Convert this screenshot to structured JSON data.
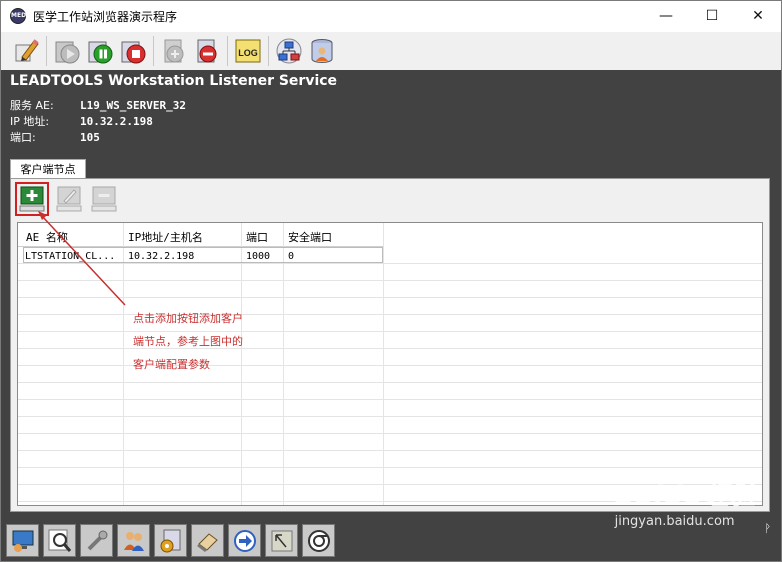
{
  "window": {
    "title": "医学工作站浏览器演示程序",
    "app_icon_text": "MED",
    "controls": {
      "minimize": "—",
      "maximize": "☐",
      "close": "✕"
    }
  },
  "toolbar": {
    "items": [
      {
        "name": "edit-pencil-icon"
      },
      {
        "name": "start-service-icon"
      },
      {
        "name": "pause-service-icon"
      },
      {
        "name": "stop-service-icon"
      },
      {
        "name": "add-server-icon"
      },
      {
        "name": "remove-server-icon"
      },
      {
        "name": "log-icon",
        "text": "LOG"
      },
      {
        "name": "network-icon"
      },
      {
        "name": "database-user-icon"
      }
    ]
  },
  "service": {
    "title": "LEADTOOLS Workstation Listener Service",
    "ae_label": "服务 AE:",
    "ae_value": "L19_WS_SERVER_32",
    "ip_label": "IP 地址:",
    "ip_value": "10.32.2.198",
    "port_label": "端口:",
    "port_value": "105"
  },
  "client_tab": {
    "label": "客户端节点"
  },
  "client_tools": {
    "add": "add-client-icon",
    "edit": "edit-client-icon",
    "remove": "remove-client-icon"
  },
  "grid": {
    "columns": [
      "AE 名称",
      "IP地址/主机名",
      "端口",
      "安全端口"
    ],
    "rows": [
      [
        "LTSTATION_CL...",
        "10.32.2.198",
        "1000",
        "0"
      ]
    ]
  },
  "annotation": {
    "lines": [
      "点击添加按钮添加客户",
      "端节点，参考上图中的",
      "客户端配置参数"
    ]
  },
  "bottombar": {
    "items": [
      "monitor-icon",
      "search-icon",
      "wrench-icon",
      "users-icon",
      "settings-icon",
      "eraser-icon",
      "forward-icon",
      "cursor-icon",
      "refresh-icon"
    ]
  },
  "pin": "ᚹ",
  "watermark": {
    "brand": "Baidu经验",
    "url": "jingyan.baidu.com"
  },
  "colors": {
    "dark_panel": "#424242",
    "annotation": "#c83030",
    "highlight": "#d02020"
  }
}
